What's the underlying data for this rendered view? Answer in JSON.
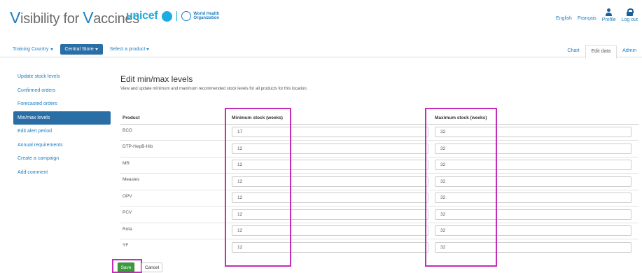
{
  "header": {
    "brand_v": "V",
    "brand_mid": "isibility for ",
    "brand_v2": "V",
    "brand_end": "accines",
    "unicef": "unicef",
    "who_line1": "World Health",
    "who_line2": "Organization",
    "lang_en": "English",
    "lang_fr": "Français",
    "profile": "Profile",
    "logout": "Log out"
  },
  "nav": {
    "country": "Training Country",
    "store": "Central Store",
    "product": "Select a product",
    "tabs": [
      "Chart",
      "Edit data",
      "Admin"
    ]
  },
  "sidebar": {
    "items": [
      "Update stock levels",
      "Confirmed orders",
      "Forecasted orders",
      "Min/max levels",
      "Edit alert period",
      "Annual requirements",
      "Create a campaign",
      "Add comment"
    ]
  },
  "main": {
    "title": "Edit min/max levels",
    "description": "View and update minimum and maximum recommended stock levels for all products for this location.",
    "columns": [
      "Product",
      "Minimum stock (weeks)",
      "Maximum stock (weeks)"
    ],
    "rows": [
      {
        "product": "BCG",
        "min": "17",
        "max": "32"
      },
      {
        "product": "DTP-HepB-Hib",
        "min": "12",
        "max": "32"
      },
      {
        "product": "MR",
        "min": "12",
        "max": "32"
      },
      {
        "product": "Measles",
        "min": "12",
        "max": "32"
      },
      {
        "product": "OPV",
        "min": "12",
        "max": "32"
      },
      {
        "product": "PCV",
        "min": "12",
        "max": "32"
      },
      {
        "product": "Rota",
        "min": "12",
        "max": "32"
      },
      {
        "product": "YF",
        "min": "12",
        "max": "32"
      }
    ],
    "save": "Save",
    "cancel": "Cancel"
  },
  "colors": {
    "highlight": "#c42db8",
    "primary": "#2a6ea6",
    "link": "#1c7dc1",
    "save": "#3d9a3d"
  }
}
